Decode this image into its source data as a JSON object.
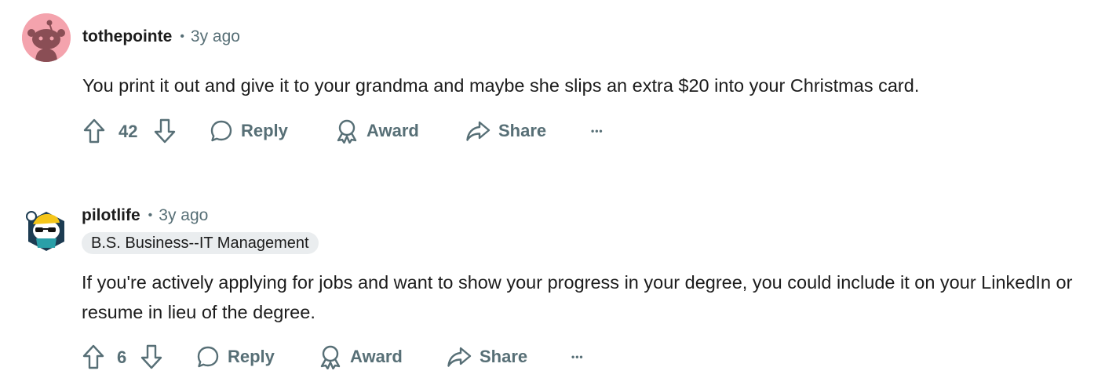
{
  "comments": [
    {
      "username": "tothepointe",
      "separator": "•",
      "time": "3y ago",
      "body": "You print it out and give it to your grandma and maybe she slips an extra $20 into your Christmas card.",
      "score": "42",
      "actions": {
        "reply": "Reply",
        "award": "Award",
        "share": "Share",
        "more": "•••"
      },
      "avatar_color": "#f4a3ad"
    },
    {
      "username": "pilotlife",
      "separator": "•",
      "time": "3y ago",
      "flair": "B.S. Business--IT Management",
      "body": "If you're actively applying for jobs and want to show your progress in your degree, you could include it on your LinkedIn or resume in lieu of the degree.",
      "score": "6",
      "actions": {
        "reply": "Reply",
        "award": "Award",
        "share": "Share",
        "more": "•••"
      },
      "avatar_color": "#1d3c52"
    }
  ],
  "colors": {
    "text": "#1c1c1c",
    "muted": "#576f76",
    "flair_bg": "#eaedef"
  }
}
